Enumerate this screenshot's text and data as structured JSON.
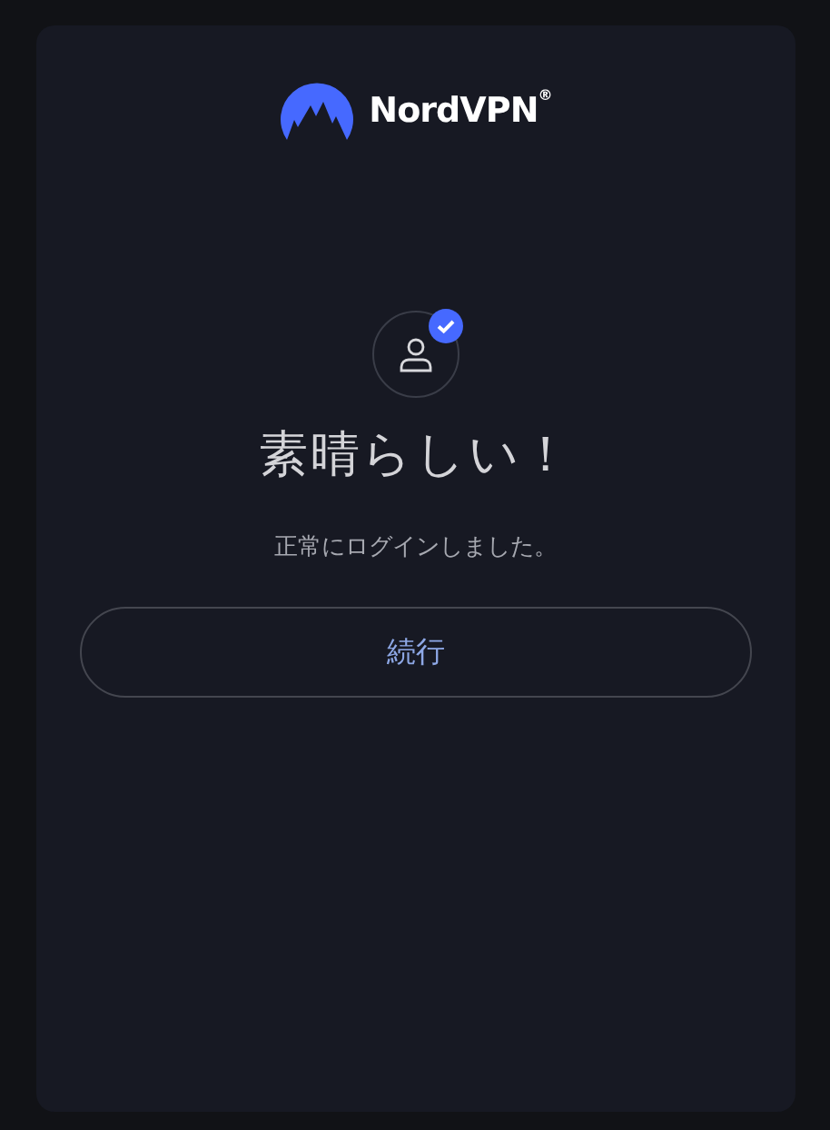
{
  "logo": {
    "text": "NordVPN",
    "mark": "®"
  },
  "title": "素晴らしい！",
  "message": "正常にログインしました。",
  "button": {
    "label": "続行"
  }
}
